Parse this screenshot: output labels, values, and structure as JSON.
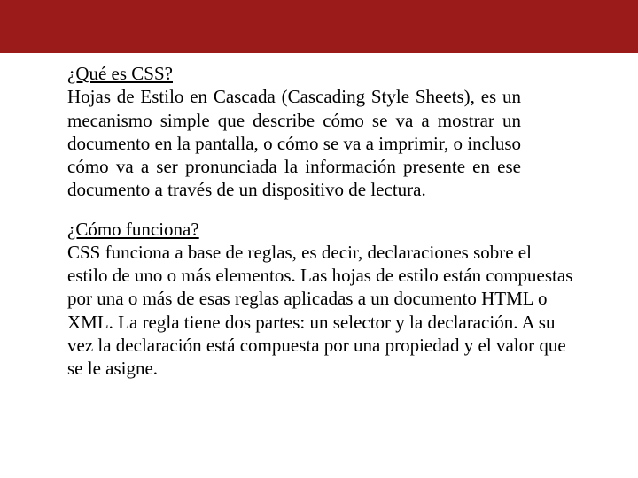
{
  "section1": {
    "heading": "¿Qué es CSS?",
    "body": "Hojas de Estilo en Cascada (Cascading Style Sheets), es un mecanismo simple que describe cómo se va a mostrar un documento en la pantalla, o cómo se va a imprimir, o incluso cómo va a ser pronunciada la información presente en ese documento a través de un dispositivo de lectura."
  },
  "section2": {
    "heading": "¿Cómo funciona?",
    "body": "CSS funciona a base de reglas, es decir, declaraciones sobre el estilo de uno o más elementos. Las hojas de estilo están compuestas por una o más de esas reglas aplicadas a un documento HTML o XML. La regla tiene dos partes: un selector y la declaración. A su vez la declaración está compuesta por una propiedad y el valor que se le asigne."
  },
  "colors": {
    "header": "#9b1b1b"
  }
}
